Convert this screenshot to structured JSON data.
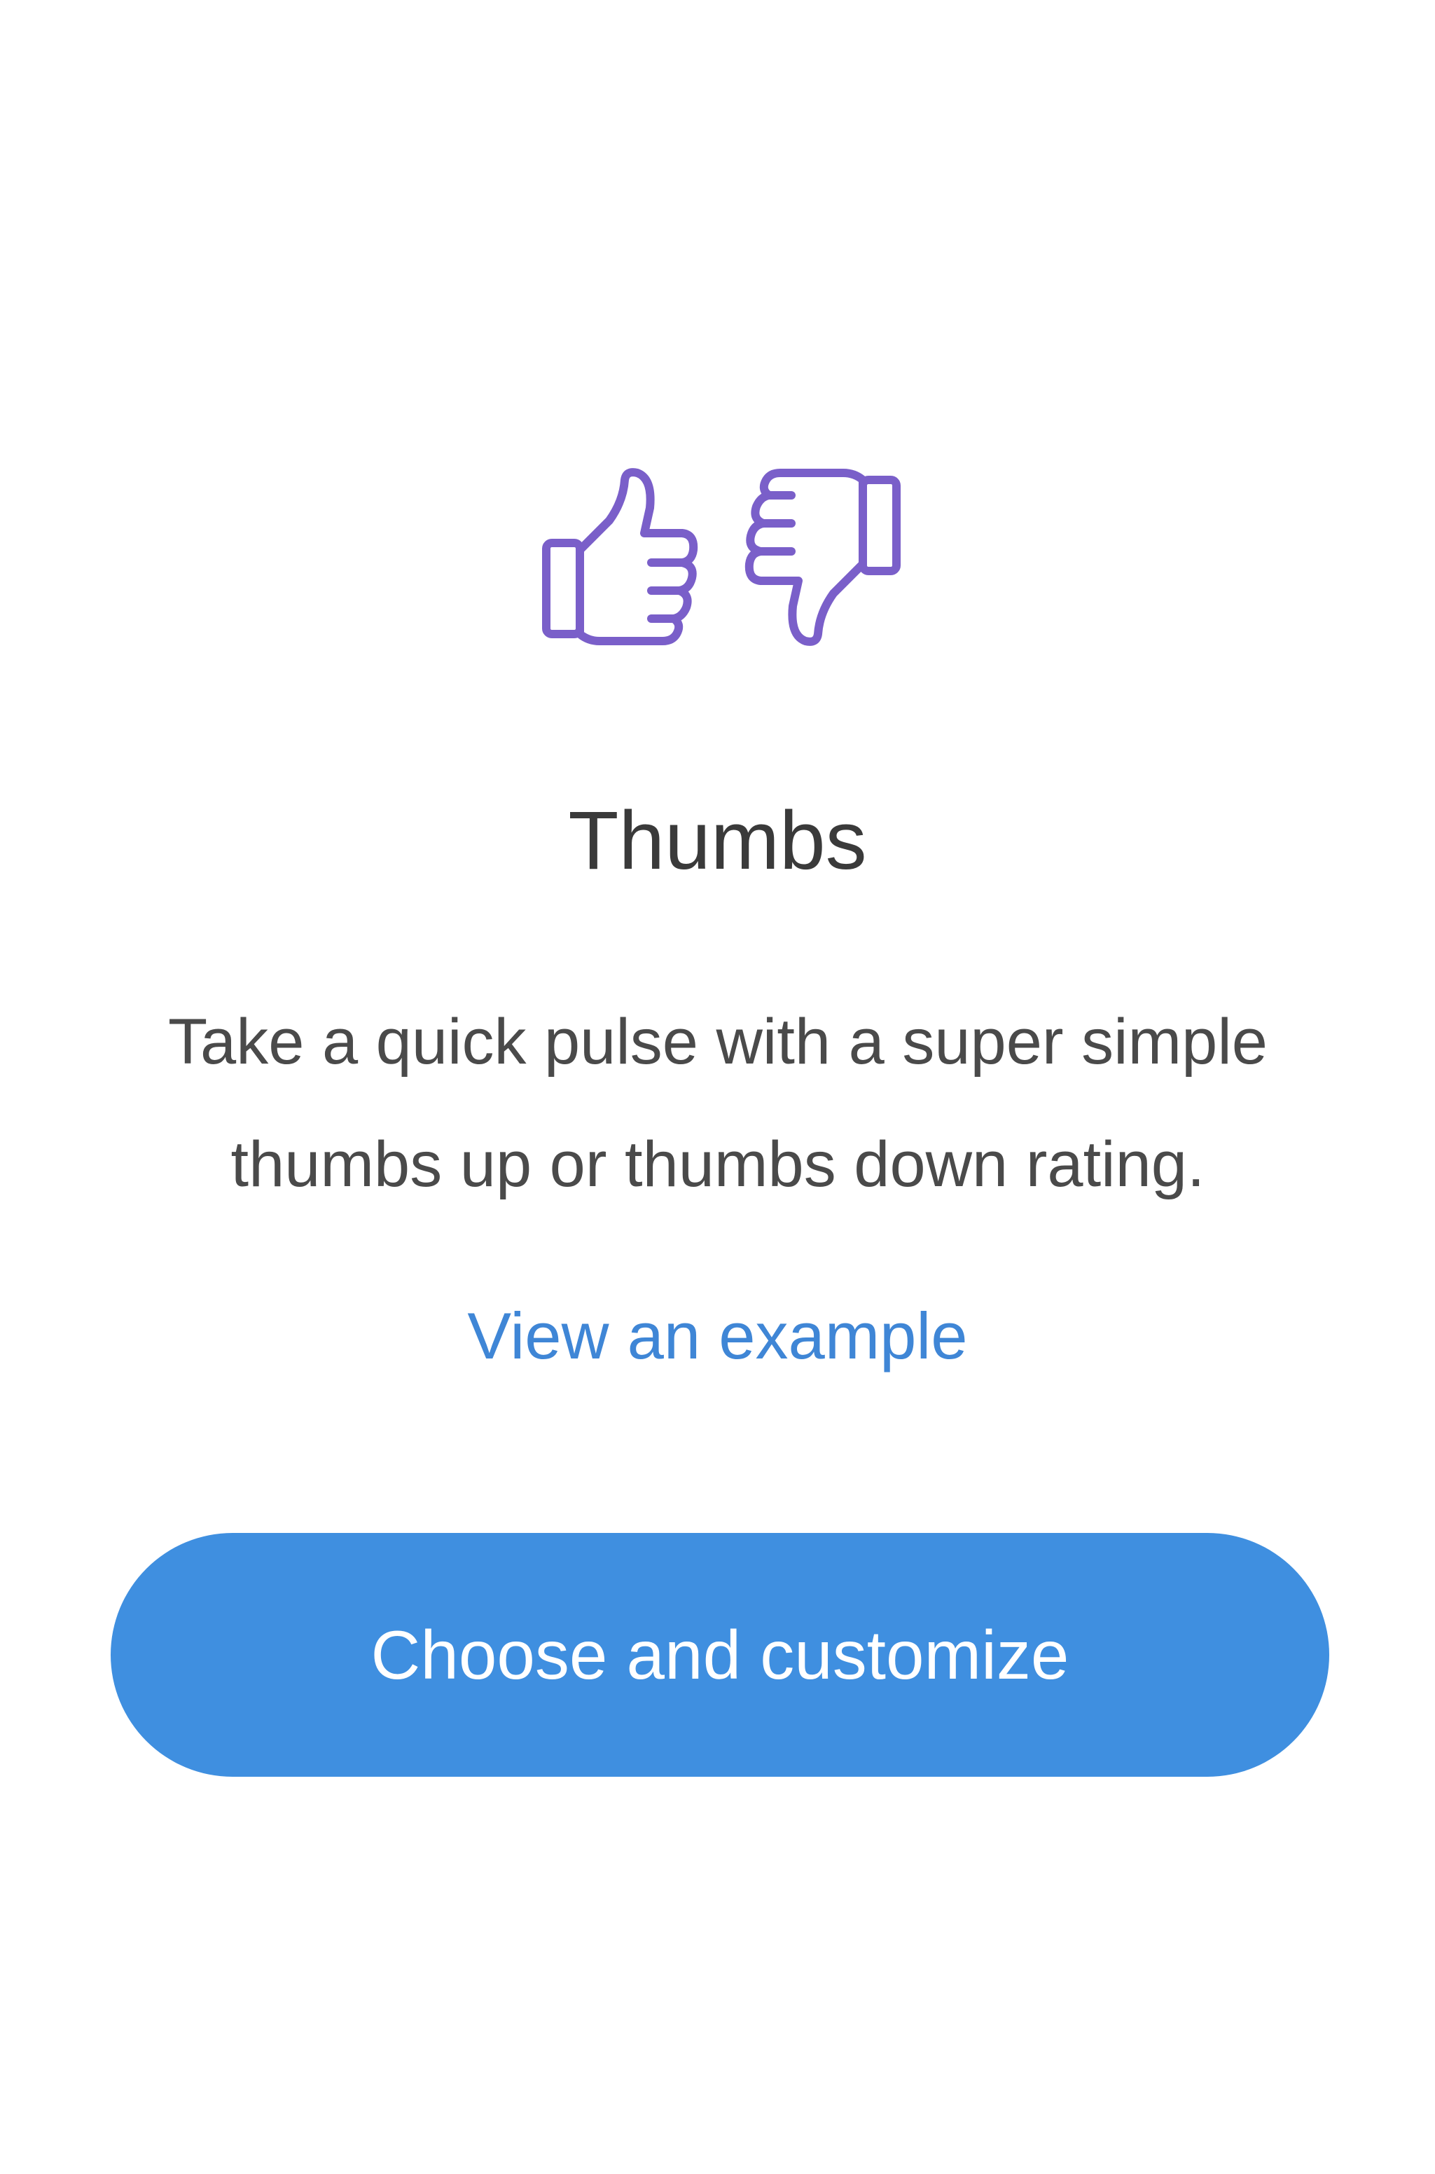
{
  "card": {
    "title": "Thumbs",
    "description": "Take a quick pulse with a super simple thumbs up or thumbs down rating.",
    "example_link": "View an example",
    "cta_label": "Choose and customize"
  },
  "icons": {
    "up": "thumbs-up-icon",
    "down": "thumbs-down-icon",
    "color": "#7a5fc9"
  },
  "colors": {
    "link": "#3f86d6",
    "button": "#3f8fe0",
    "title": "#3a3a3a",
    "body": "#4a4a4a"
  }
}
